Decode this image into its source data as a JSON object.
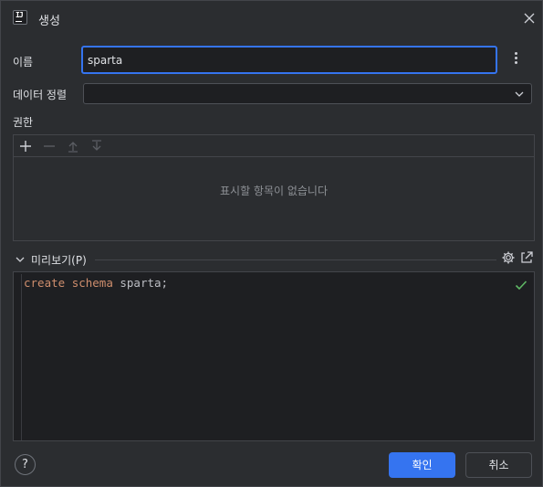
{
  "window": {
    "title": "생성",
    "icon": "intellij-app-icon"
  },
  "form": {
    "name_label": "이름",
    "name_value": "sparta",
    "collation_label": "데이터 정렬",
    "collation_value": "",
    "permissions_label": "권한",
    "permissions_empty": "표시할 항목이 없습니다"
  },
  "permissions_toolbar": [
    "add-icon",
    "remove-icon",
    "move-up-icon",
    "move-down-icon"
  ],
  "preview": {
    "label": "미리보기(P)",
    "code_tokens": [
      {
        "text": "create",
        "kind": "kw"
      },
      {
        "text": " ",
        "kind": "id"
      },
      {
        "text": "schema",
        "kind": "kw"
      },
      {
        "text": " sparta;",
        "kind": "id"
      }
    ]
  },
  "buttons": {
    "help": "?",
    "ok": "확인",
    "cancel": "취소"
  },
  "colors": {
    "accent": "#3574f0",
    "background": "#2b2d30",
    "editor_bg": "#1e1f22",
    "keyword": "#cf8e6d",
    "success": "#5fb865"
  }
}
